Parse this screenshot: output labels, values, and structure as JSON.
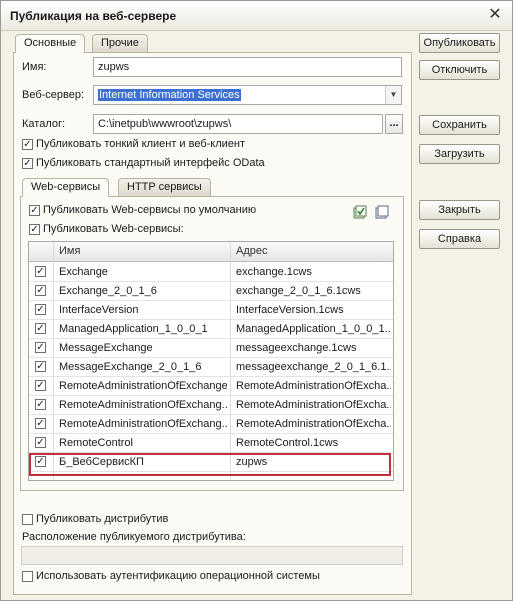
{
  "window": {
    "title": "Публикация на веб-сервере",
    "close": "✕"
  },
  "tabs": {
    "main": "Основные",
    "other": "Прочие"
  },
  "form": {
    "name_label": "Имя:",
    "name_value": "zupws",
    "server_label": "Веб-сервер:",
    "server_value": "Internet Information Services",
    "catalog_label": "Каталог:",
    "catalog_value": "C:\\inetpub\\wwwroot\\zupws\\",
    "catalog_btn": "...",
    "publish_thin": "Публиковать тонкий клиент и веб-клиент",
    "publish_odata": "Публиковать стандартный интерфейс OData"
  },
  "inner_tabs": {
    "web": "Web-сервисы",
    "http": "HTTP сервисы"
  },
  "web": {
    "default_label": "Публиковать Web-сервисы по умолчанию",
    "publish_label": "Публиковать Web-сервисы:",
    "col_name": "Имя",
    "col_address": "Адрес",
    "rows": [
      {
        "checked": true,
        "name": "Exchange",
        "address": "exchange.1cws"
      },
      {
        "checked": true,
        "name": "Exchange_2_0_1_6",
        "address": "exchange_2_0_1_6.1cws"
      },
      {
        "checked": true,
        "name": "InterfaceVersion",
        "address": "InterfaceVersion.1cws"
      },
      {
        "checked": true,
        "name": "ManagedApplication_1_0_0_1",
        "address": "ManagedApplication_1_0_0_1..."
      },
      {
        "checked": true,
        "name": "MessageExchange",
        "address": "messageexchange.1cws"
      },
      {
        "checked": true,
        "name": "MessageExchange_2_0_1_6",
        "address": "messageexchange_2_0_1_6.1..."
      },
      {
        "checked": true,
        "name": "RemoteAdministrationOfExchange",
        "address": "RemoteAdministrationOfExcha..."
      },
      {
        "checked": true,
        "name": "RemoteAdministrationOfExchang...",
        "address": "RemoteAdministrationOfExcha..."
      },
      {
        "checked": true,
        "name": "RemoteAdministrationOfExchang...",
        "address": "RemoteAdministrationOfExcha..."
      },
      {
        "checked": true,
        "name": "RemoteControl",
        "address": "RemoteControl.1cws"
      },
      {
        "checked": true,
        "name": "Б_ВебСервисКП",
        "address": "zupws"
      }
    ]
  },
  "bottom": {
    "publish_distr": "Публиковать дистрибутив",
    "distr_location": "Расположение публикуемого дистрибутива:",
    "os_auth": "Использовать аутентификацию операционной системы"
  },
  "buttons": {
    "publish": "Опубликовать",
    "disable": "Отключить",
    "save": "Сохранить",
    "load": "Загрузить",
    "close": "Закрыть",
    "help": "Справка"
  },
  "colors": {
    "highlight_border": "#c0313a",
    "selection": "#3b6fd1"
  }
}
